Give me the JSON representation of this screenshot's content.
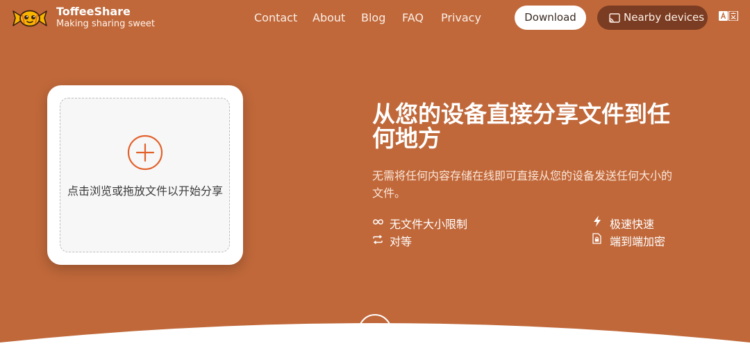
{
  "brand": {
    "name": "ToffeeShare",
    "tagline": "Making sharing sweet"
  },
  "nav": {
    "links": [
      "Contact",
      "About",
      "Blog",
      "FAQ",
      "Privacy"
    ],
    "download_label": "Download",
    "nearby_label": "Nearby devices"
  },
  "drop": {
    "text": "点击浏览或拖放文件以开始分享"
  },
  "hero": {
    "title": "从您的设备直接分享文件到任何地方",
    "subtitle": "无需将任何内容存储在线即可直接从您的设备发送任何大小的文件。"
  },
  "features": [
    {
      "icon": "infinity-icon",
      "label": "无文件大小限制"
    },
    {
      "icon": "lightning-icon",
      "label": "极速快速"
    },
    {
      "icon": "swap-arrows-icon",
      "label": "对等"
    },
    {
      "icon": "lock-file-icon",
      "label": "端到端加密"
    }
  ],
  "colors": {
    "background": "#c0683a",
    "accent": "#e2612b",
    "dark_button": "#7a3c22"
  }
}
